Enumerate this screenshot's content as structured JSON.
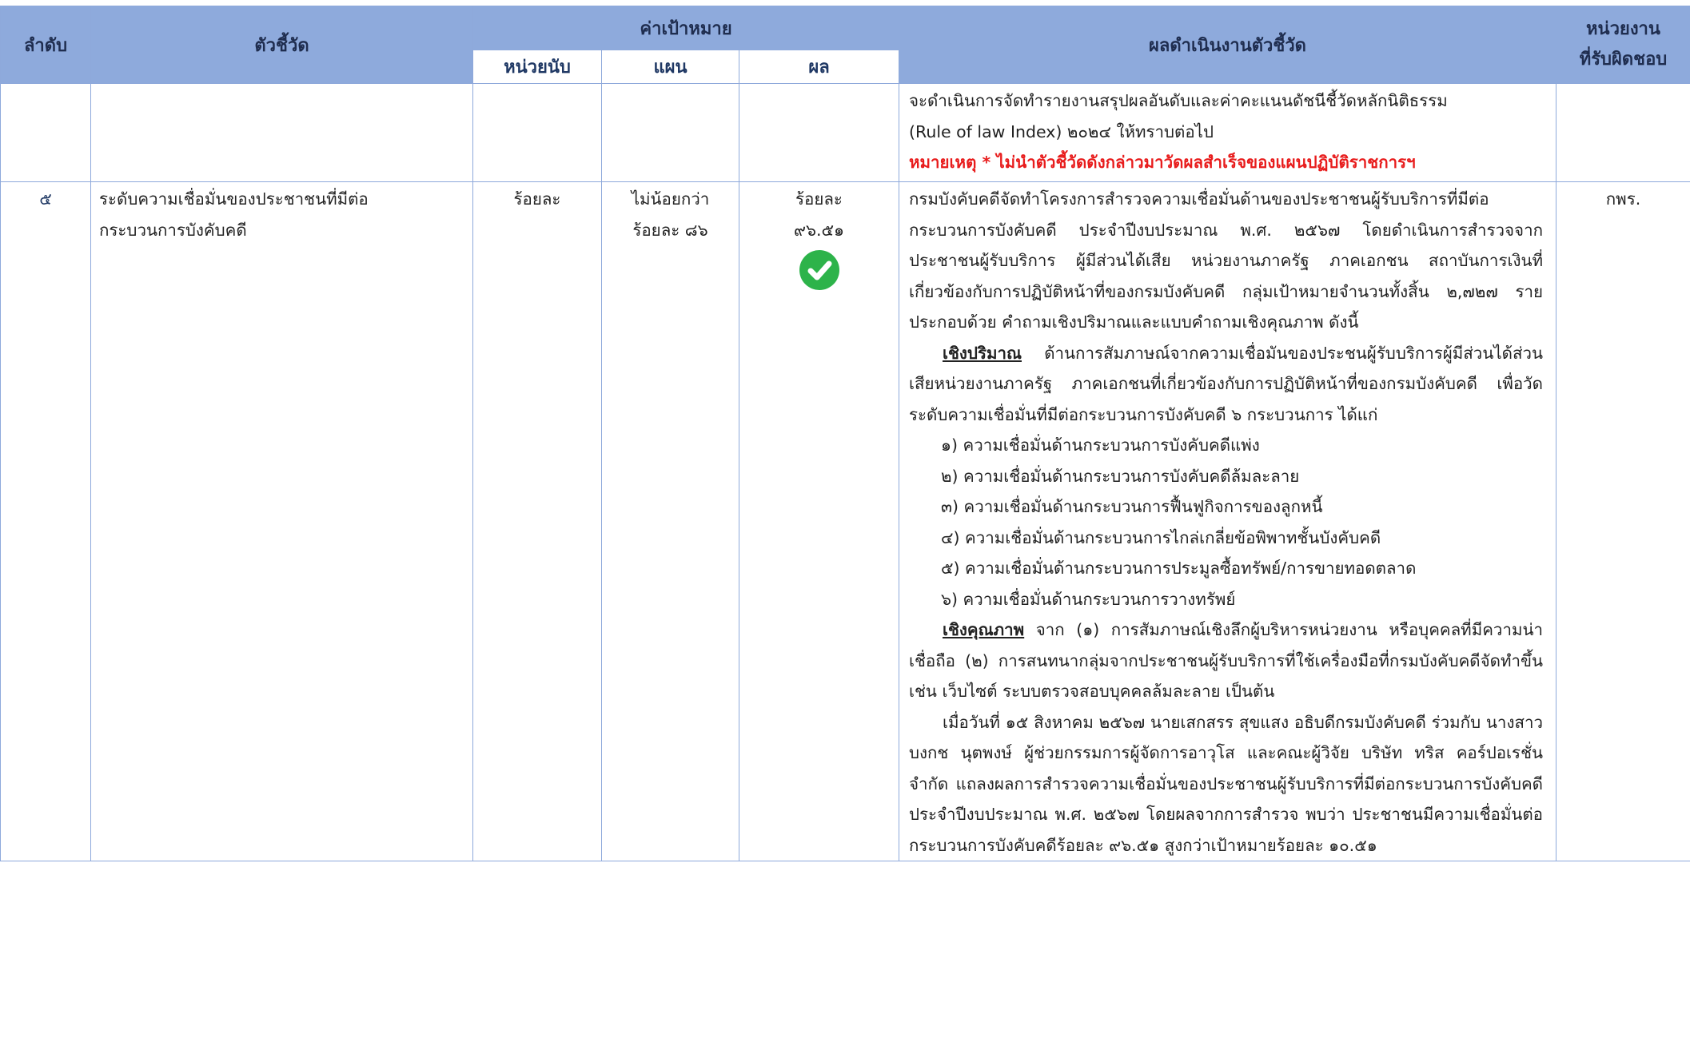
{
  "header": {
    "col_order": "ลำดับ",
    "col_indicator": "ตัวชี้วัด",
    "col_target": "ค่าเป้าหมาย",
    "col_unit": "หน่วยนับ",
    "col_plan": "แผน",
    "col_result": "ผล",
    "col_performance": "ผลดำเนินงานตัวชี้วัด",
    "col_responsible_line1": "หน่วยงาน",
    "col_responsible_line2": "ที่รับผิดชอบ"
  },
  "row_prev": {
    "line1": "จะดำเนินการจัดทำรายงานสรุปผลอันดับและค่าคะแนนดัชนีชี้วัดหลักนิติธรรม",
    "line2": "(Rule of law Index) ๒๐๒๔ ให้ทราบต่อไป",
    "note": "หมายเหตุ * ไม่นำตัวชี้วัดดังกล่าวมาวัดผลสำเร็จของแผนปฏิบัติราชการฯ"
  },
  "row5": {
    "order": "๕",
    "indicator_line1": "ระดับความเชื่อมั่นของประชาชนที่มีต่อ",
    "indicator_line2": "กระบวนการบังคับคดี",
    "unit": "ร้อยละ",
    "plan_line1": "ไม่น้อยกว่า",
    "plan_line2": "ร้อยละ ๘๖",
    "result_line1": "ร้อยละ",
    "result_line2": "๙๖.๕๑",
    "result_icon": "check-circle-icon",
    "responsible": "กพร.",
    "intro": "กรมบังคับคดีจัดทำโครงการสำรวจความเชื่อมั่นด้านของประชาชนผู้รับบริการที่มีต่อกระบวนการบังคับคดี ประจำปีงบประมาณ พ.ศ. ๒๕๖๗ โดยดำเนินการสำรวจจากประชาชนผู้รับบริการ ผู้มีส่วนได้เสีย หน่วยงานภาครัฐ ภาคเอกชน สถาบันการเงินที่เกี่ยวข้องกับการปฏิบัติหน้าที่ของกรมบังคับคดี กลุ่มเป้าหมายจำนวนทั้งสิ้น ๒,๗๒๗ ราย ประกอบด้วย คำถามเชิงปริมาณและแบบคำถามเชิงคุณภาพ ดังนี้",
    "quant_label": "เชิงปริมาณ",
    "quant_text": " ด้านการสัมภาษณ์จากความเชื่อมันของประชนผู้รับบริการผู้มีส่วนได้ส่วนเสียหน่วยงานภาครัฐ ภาคเอกชนที่เกี่ยวข้องกับการปฏิบัติหน้าที่ของกรมบังคับคดี เพื่อวัดระดับความเชื่อมั่นที่มีต่อกระบวนการบังคับคดี ๖ กระบวนการ ได้แก่",
    "items": [
      "๑) ความเชื่อมั่นด้านกระบวนการบังคับคดีแพ่ง",
      "๒) ความเชื่อมั่นด้านกระบวนการบังคับคดีล้มละลาย",
      "๓) ความเชื่อมั่นด้านกระบวนการฟื้นฟูกิจการของลูกหนี้",
      "๔) ความเชื่อมั่นด้านกระบวนการไกล่เกลี่ยข้อพิพาทชั้นบังคับคดี",
      "๕) ความเชื่อมั่นด้านกระบวนการประมูลซื้อทรัพย์/การขายทอดตลาด",
      "๖) ความเชื่อมั่นด้านกระบวนการวางทรัพย์"
    ],
    "qual_label": "เชิงคุณภาพ",
    "qual_text": " จาก (๑) การสัมภาษณ์เชิงลึกผู้บริหารหน่วยงาน หรือบุคคลที่มีความน่าเชื่อถือ (๒) การสนทนากลุ่มจากประชาชนผู้รับบริการที่ใช้เครื่องมือที่กรมบังคับคดีจัดทำขึ้น เช่น เว็บไซต์ ระบบตรวจสอบบุคคลล้มละลาย เป็นต้น",
    "final": "เมื่อวันที่ ๑๕ สิงหาคม ๒๕๖๗ นายเสกสรร สุขแสง อธิบดีกรมบังคับคดี ร่วมกับ นางสาวบงกช นุตพงษ์ ผู้ช่วยกรรมการผู้จัดการอาวุโส และคณะผู้วิจัย บริษัท ทริส คอร์ปอเรชั่น จำกัด แถลงผลการสำรวจความเชื่อมั่นของประชาชนผู้รับบริการที่มีต่อกระบวนการบังคับคดี ประจำปีงบประมาณ พ.ศ. ๒๕๖๗ โดยผลจากการสำรวจ พบว่า ประชาชนมีความเชื่อมั่นต่อกระบวนการบังคับคดีร้อยละ ๙๖.๕๑ สูงกว่าเป้าหมายร้อยละ ๑๐.๕๑"
  }
}
